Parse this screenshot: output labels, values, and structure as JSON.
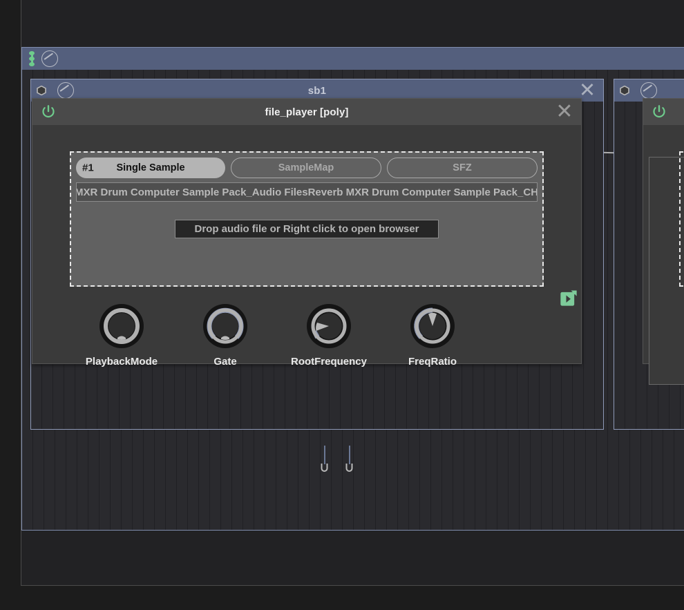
{
  "app": {
    "background_color": "#1c1c1c",
    "accent_blue": "#545f7d",
    "accent_green": "#6ecb8c",
    "panel_gray": "#3a3a3a"
  },
  "outer_chain": {
    "name": "outer-container"
  },
  "chain_level1": {
    "icons": [
      "bipolar-icon",
      "small-knob-icon"
    ]
  },
  "chain_level2": {
    "title": "sb1",
    "close_label": "✕"
  },
  "chain_level2_right": {
    "title": "",
    "close_label": "✕"
  },
  "module": {
    "title": "file_player [poly]",
    "power_label": "power-icon",
    "close_label": "✕",
    "tabs": [
      {
        "index_label": "#1",
        "label": "Single Sample",
        "active": true
      },
      {
        "index_label": "",
        "label": "SampleMap",
        "active": false
      },
      {
        "index_label": "",
        "label": "SFZ",
        "active": false
      }
    ],
    "file_path": "Reverb MXR Drum Computer Sample Pack_Audio FilesReverb MXR Drum Computer Sample Pack_CHH.wav",
    "dropzone_text": "Drop audio file or Right click to open browser",
    "expand_icon": "expand-icon",
    "knobs": [
      {
        "label": "PlaybackMode",
        "arc_start": -135,
        "arc_end": -135,
        "pointer": -135,
        "ring": "dark"
      },
      {
        "label": "Gate",
        "arc_start": -135,
        "arc_end": 135,
        "pointer": 135,
        "ring": "light"
      },
      {
        "label": "RootFrequency",
        "arc_start": -135,
        "arc_end": -100,
        "pointer": -100,
        "ring": "mixed"
      },
      {
        "label": "FreqRatio",
        "arc_start": -135,
        "arc_end": 0,
        "pointer": 0,
        "ring": "mixed"
      }
    ]
  }
}
